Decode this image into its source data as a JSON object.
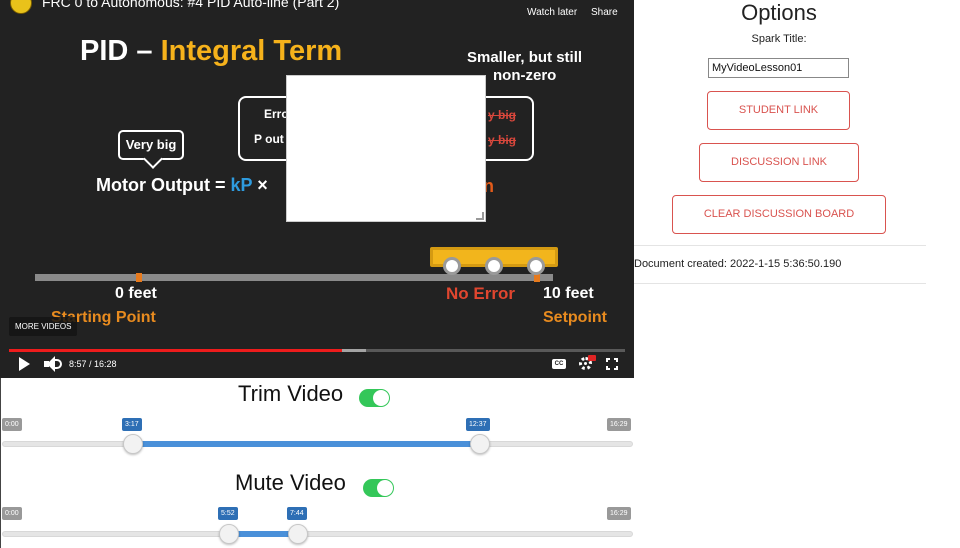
{
  "player": {
    "video_title": "FRC 0 to Autonomous: #4 PID Auto-line (Part 2)",
    "watch_later": "Watch later",
    "share": "Share",
    "more_videos": "MORE VIDEOS",
    "time": "8:57 / 16:28",
    "cc": "CC",
    "progress_played": 0.54,
    "progress_buffered": 0.58
  },
  "slide": {
    "title_part1": "PID",
    "title_dash": "–",
    "title_part2": "Integral Term",
    "smaller_line1": "Smaller, but still",
    "smaller_line2": "non-zero",
    "very_big": "Very big",
    "error_label": "Erro",
    "pout_label": "P out",
    "strike1": "y big",
    "strike2": "y big",
    "motor_prefix": "Motor Output = ",
    "motor_kp": "kP",
    "motor_times": " ×",
    "motor_tail": "n",
    "zero_feet": "0 feet",
    "starting_point": "Starting Point",
    "no_error": "No Error",
    "ten_feet": "10 feet",
    "setpoint": "Setpoint"
  },
  "options": {
    "title": "Options",
    "spark_label": "Spark Title:",
    "spark_value": "MyVideoLesson01",
    "student_link": "STUDENT LINK",
    "discussion_link": "DISCUSSION LINK",
    "clear_board": "CLEAR DISCUSSION BOARD",
    "doc_created": "Document created: 2022-1-15 5:36:50.190"
  },
  "trim": {
    "title": "Trim Video",
    "enabled": true,
    "min": "0:00",
    "max": "16:29",
    "start": "3:17",
    "end": "12:37"
  },
  "mute": {
    "title": "Mute Video",
    "enabled": true,
    "min": "0:00",
    "max": "16:29",
    "start": "5:52",
    "end": "7:44"
  }
}
